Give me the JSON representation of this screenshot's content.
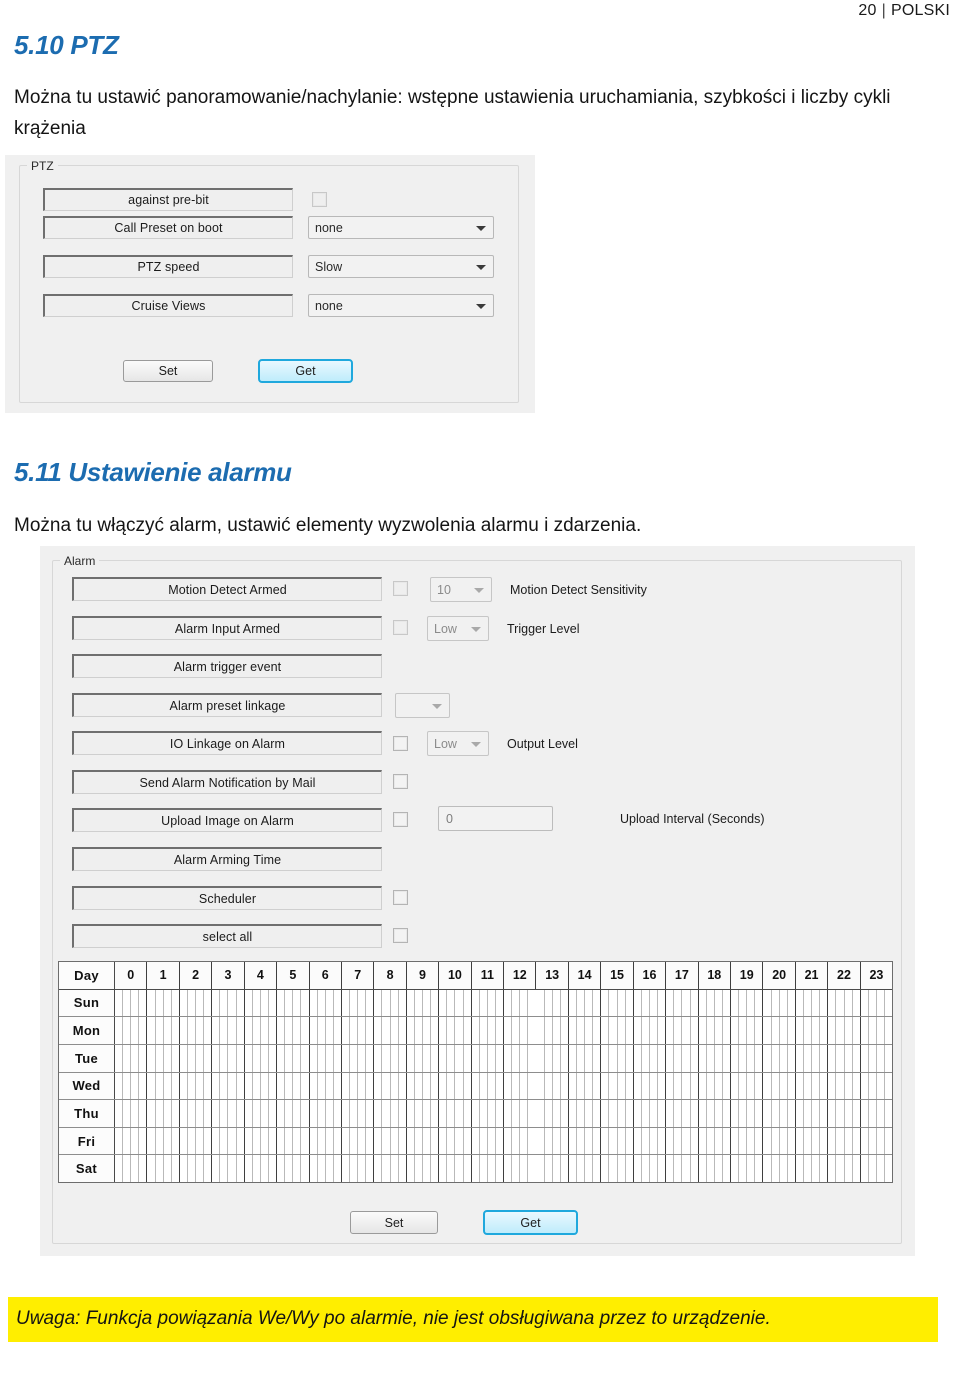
{
  "page_header": {
    "number": "20",
    "separator": "|",
    "language": "POLSKI"
  },
  "sections": {
    "ptz": {
      "heading": "5.10 PTZ",
      "description": "Można tu ustawić panoramowanie/nachylanie: wstępne ustawienia uruchamiania, szybkości i liczby cykli krążenia",
      "panel": {
        "group_label": "PTZ",
        "rows": [
          {
            "label": "against pre-bit",
            "control": "checkbox",
            "checked": false
          },
          {
            "label": "Call Preset on boot",
            "control": "combo",
            "value": "none"
          },
          {
            "label": "PTZ speed",
            "control": "combo",
            "value": "Slow"
          },
          {
            "label": "Cruise Views",
            "control": "combo",
            "value": "none"
          }
        ],
        "set_button": "Set",
        "get_button": "Get"
      }
    },
    "alarm": {
      "heading": "5.11 Ustawienie alarmu",
      "description": "Można tu włączyć alarm, ustawić elementy wyzwolenia alarmu i zdarzenia.",
      "panel": {
        "group_label": "Alarm",
        "rows": [
          {
            "label": "Motion Detect Armed",
            "checkbox": true,
            "control": "combo",
            "value": "10",
            "caption": "Motion Detect Sensitivity"
          },
          {
            "label": "Alarm Input Armed",
            "checkbox": true,
            "control": "combo",
            "value": "Low",
            "caption": "Trigger Level"
          },
          {
            "label": "Alarm trigger event",
            "checkbox": false,
            "control": "none",
            "value": "",
            "caption": ""
          },
          {
            "label": "Alarm preset linkage",
            "checkbox": false,
            "control": "combo",
            "value": "",
            "caption": ""
          },
          {
            "label": "IO Linkage on Alarm",
            "checkbox": true,
            "control": "combo",
            "value": "Low",
            "caption": "Output Level"
          },
          {
            "label": "Send Alarm Notification by Mail",
            "checkbox": true,
            "control": "none",
            "value": "",
            "caption": ""
          },
          {
            "label": "Upload Image on Alarm",
            "checkbox": true,
            "control": "textbox",
            "value": "0",
            "caption": "Upload Interval (Seconds)"
          },
          {
            "label": "Alarm Arming Time",
            "checkbox": false,
            "control": "none",
            "value": "",
            "caption": ""
          },
          {
            "label": "Scheduler",
            "checkbox": true,
            "control": "none",
            "value": "",
            "caption": ""
          },
          {
            "label": "select all",
            "checkbox": true,
            "control": "none",
            "value": "",
            "caption": ""
          }
        ],
        "scheduler": {
          "day_header": "Day",
          "hours": [
            "0",
            "1",
            "2",
            "3",
            "4",
            "5",
            "6",
            "7",
            "8",
            "9",
            "10",
            "11",
            "12",
            "13",
            "14",
            "15",
            "16",
            "17",
            "18",
            "19",
            "20",
            "21",
            "22",
            "23"
          ],
          "days": [
            "Sun",
            "Mon",
            "Tue",
            "Wed",
            "Thu",
            "Fri",
            "Sat"
          ],
          "slots_per_hour": 4
        },
        "set_button": "Set",
        "get_button": "Get"
      }
    }
  },
  "note": "Uwaga: Funkcja powiązania We/Wy po alarmie, nie jest obsługiwana przez to urządzenie.",
  "colors": {
    "heading": "#1c6cb0",
    "note_background": "#ffee00",
    "primary_button_border": "#1fa8dd"
  }
}
